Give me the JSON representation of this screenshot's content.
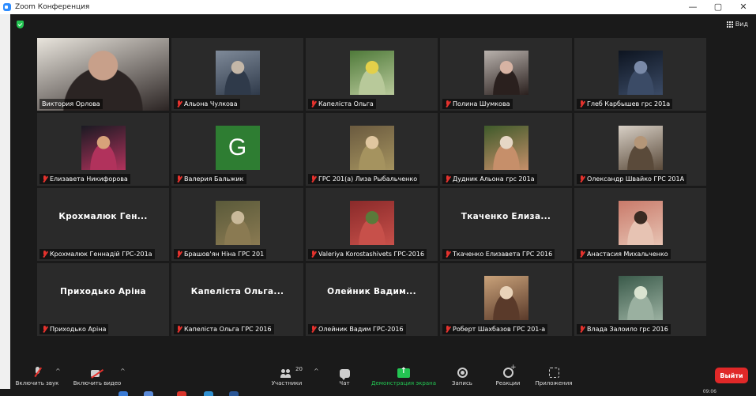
{
  "window": {
    "title": "Zoom Конференция",
    "controls": {
      "minimize": "—",
      "maximize": "▢",
      "close": "✕"
    }
  },
  "header": {
    "view_label": "Вид"
  },
  "participants": [
    {
      "name": "Виктория Орлова",
      "type": "video",
      "active": true,
      "muted": false,
      "colors": [
        "#e9e5dd",
        "#2b2423",
        "#c8a08a"
      ]
    },
    {
      "name": "Альона Чулкова",
      "type": "photo",
      "muted": true,
      "colors": [
        "#7f8a99",
        "#2f3a4a",
        "#c4b7a8"
      ]
    },
    {
      "name": "Капеліста Ольга",
      "type": "photo",
      "muted": true,
      "colors": [
        "#4f7a3a",
        "#b8c99a",
        "#e3d04a"
      ]
    },
    {
      "name": "Полина Шумкова",
      "type": "photo",
      "muted": true,
      "colors": [
        "#b9b2ad",
        "#2a201e",
        "#d7b3a3"
      ]
    },
    {
      "name": "Глеб Карбышев грс 201а",
      "type": "photo",
      "muted": true,
      "colors": [
        "#0d1420",
        "#3b4b66",
        "#7a8aa8"
      ]
    },
    {
      "name": "Елизавета Никифорова",
      "type": "photo",
      "muted": true,
      "colors": [
        "#1a1a22",
        "#b1325c",
        "#d7a27a"
      ]
    },
    {
      "name": "Валерия Бальжик",
      "type": "letter",
      "letter": "G",
      "muted": true,
      "colors": [
        "#2e7d32"
      ]
    },
    {
      "name": "ГРС 201(а) Лиза Рыбальченко",
      "type": "photo",
      "muted": true,
      "colors": [
        "#6a5a3f",
        "#a5935f",
        "#e0c7a0"
      ]
    },
    {
      "name": "Дудник Альона грс 201а",
      "type": "photo",
      "muted": true,
      "colors": [
        "#3e5a2a",
        "#c68f6a",
        "#e6d7c5"
      ]
    },
    {
      "name": "Олександр Швайко ГРС 201А",
      "type": "photo",
      "muted": true,
      "colors": [
        "#d8d0c6",
        "#5a4a3a",
        "#b49678"
      ]
    },
    {
      "name": "Крохмалюк Геннадій ГРС-201а",
      "type": "name",
      "display": "Крохмалюк  Ген...",
      "muted": true
    },
    {
      "name": "Брашов'ян Ніна ГРС 201",
      "type": "photo",
      "muted": true,
      "colors": [
        "#5a5a3a",
        "#8a7a52",
        "#c9b99a"
      ]
    },
    {
      "name": "Valeriya Korostashivets ГРС-2016",
      "type": "photo",
      "muted": true,
      "colors": [
        "#8a2a2a",
        "#c7504a",
        "#5a7a3a"
      ]
    },
    {
      "name": "Ткаченко Елизавета ГРС 2016",
      "type": "name",
      "display": "Ткаченко  Елиза...",
      "muted": true
    },
    {
      "name": "Анастасия Михальченко",
      "type": "photo",
      "muted": true,
      "colors": [
        "#c97a6a",
        "#e7c3b3",
        "#3a2a22"
      ]
    },
    {
      "name": "Приходько Аріна",
      "type": "name",
      "display": "Приходько  Аріна",
      "muted": true
    },
    {
      "name": "Капеліста Ольга ГРС 2016",
      "type": "name",
      "display": "Капеліста  Ольга...",
      "muted": true
    },
    {
      "name": "Олейник Вадим ГРС-2016",
      "type": "name",
      "display": "Олейник  Вадим...",
      "muted": true
    },
    {
      "name": "Роберт Шахбазов ГРС 201-а",
      "type": "photo",
      "muted": true,
      "colors": [
        "#c9a27a",
        "#5a3a2a",
        "#e9d3b9"
      ]
    },
    {
      "name": "Влада Залоило грс 2016",
      "type": "photo",
      "muted": true,
      "colors": [
        "#3a5a4a",
        "#9ab0a0",
        "#d9e3d0"
      ]
    }
  ],
  "toolbar": {
    "audio_label": "Включить звук",
    "video_label": "Включить видео",
    "participants_label": "Участники",
    "participants_count": "20",
    "chat_label": "Чат",
    "share_label": "Демонстрация экрана",
    "record_label": "Запись",
    "reactions_label": "Реакции",
    "apps_label": "Приложения",
    "leave_label": "Выйти",
    "caret": "^"
  },
  "taskbar": {
    "clock": "09:06"
  },
  "colors": {
    "background": "#1a1a1a",
    "tile": "#2a2a2a",
    "active_border": "#c8e35a",
    "accent_green": "#23c552",
    "leave_red": "#e02828",
    "muted_red": "#e5322d"
  }
}
